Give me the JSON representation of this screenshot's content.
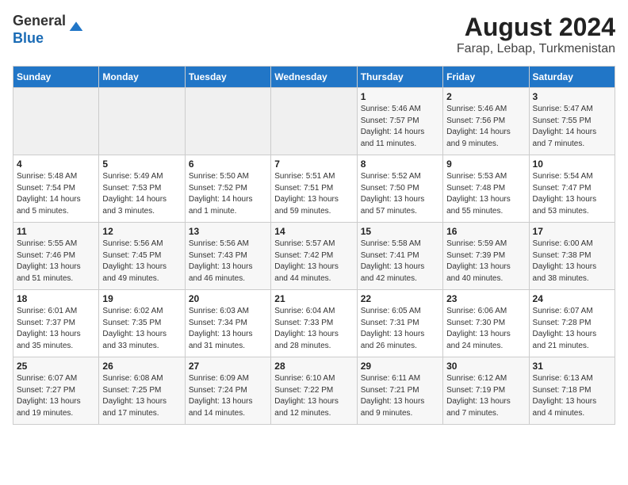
{
  "header": {
    "logo_line1": "General",
    "logo_line2": "Blue",
    "title": "August 2024",
    "subtitle": "Farap, Lebap, Turkmenistan"
  },
  "weekdays": [
    "Sunday",
    "Monday",
    "Tuesday",
    "Wednesday",
    "Thursday",
    "Friday",
    "Saturday"
  ],
  "weeks": [
    [
      {
        "day": "",
        "info": ""
      },
      {
        "day": "",
        "info": ""
      },
      {
        "day": "",
        "info": ""
      },
      {
        "day": "",
        "info": ""
      },
      {
        "day": "1",
        "info": "Sunrise: 5:46 AM\nSunset: 7:57 PM\nDaylight: 14 hours\nand 11 minutes."
      },
      {
        "day": "2",
        "info": "Sunrise: 5:46 AM\nSunset: 7:56 PM\nDaylight: 14 hours\nand 9 minutes."
      },
      {
        "day": "3",
        "info": "Sunrise: 5:47 AM\nSunset: 7:55 PM\nDaylight: 14 hours\nand 7 minutes."
      }
    ],
    [
      {
        "day": "4",
        "info": "Sunrise: 5:48 AM\nSunset: 7:54 PM\nDaylight: 14 hours\nand 5 minutes."
      },
      {
        "day": "5",
        "info": "Sunrise: 5:49 AM\nSunset: 7:53 PM\nDaylight: 14 hours\nand 3 minutes."
      },
      {
        "day": "6",
        "info": "Sunrise: 5:50 AM\nSunset: 7:52 PM\nDaylight: 14 hours\nand 1 minute."
      },
      {
        "day": "7",
        "info": "Sunrise: 5:51 AM\nSunset: 7:51 PM\nDaylight: 13 hours\nand 59 minutes."
      },
      {
        "day": "8",
        "info": "Sunrise: 5:52 AM\nSunset: 7:50 PM\nDaylight: 13 hours\nand 57 minutes."
      },
      {
        "day": "9",
        "info": "Sunrise: 5:53 AM\nSunset: 7:48 PM\nDaylight: 13 hours\nand 55 minutes."
      },
      {
        "day": "10",
        "info": "Sunrise: 5:54 AM\nSunset: 7:47 PM\nDaylight: 13 hours\nand 53 minutes."
      }
    ],
    [
      {
        "day": "11",
        "info": "Sunrise: 5:55 AM\nSunset: 7:46 PM\nDaylight: 13 hours\nand 51 minutes."
      },
      {
        "day": "12",
        "info": "Sunrise: 5:56 AM\nSunset: 7:45 PM\nDaylight: 13 hours\nand 49 minutes."
      },
      {
        "day": "13",
        "info": "Sunrise: 5:56 AM\nSunset: 7:43 PM\nDaylight: 13 hours\nand 46 minutes."
      },
      {
        "day": "14",
        "info": "Sunrise: 5:57 AM\nSunset: 7:42 PM\nDaylight: 13 hours\nand 44 minutes."
      },
      {
        "day": "15",
        "info": "Sunrise: 5:58 AM\nSunset: 7:41 PM\nDaylight: 13 hours\nand 42 minutes."
      },
      {
        "day": "16",
        "info": "Sunrise: 5:59 AM\nSunset: 7:39 PM\nDaylight: 13 hours\nand 40 minutes."
      },
      {
        "day": "17",
        "info": "Sunrise: 6:00 AM\nSunset: 7:38 PM\nDaylight: 13 hours\nand 38 minutes."
      }
    ],
    [
      {
        "day": "18",
        "info": "Sunrise: 6:01 AM\nSunset: 7:37 PM\nDaylight: 13 hours\nand 35 minutes."
      },
      {
        "day": "19",
        "info": "Sunrise: 6:02 AM\nSunset: 7:35 PM\nDaylight: 13 hours\nand 33 minutes."
      },
      {
        "day": "20",
        "info": "Sunrise: 6:03 AM\nSunset: 7:34 PM\nDaylight: 13 hours\nand 31 minutes."
      },
      {
        "day": "21",
        "info": "Sunrise: 6:04 AM\nSunset: 7:33 PM\nDaylight: 13 hours\nand 28 minutes."
      },
      {
        "day": "22",
        "info": "Sunrise: 6:05 AM\nSunset: 7:31 PM\nDaylight: 13 hours\nand 26 minutes."
      },
      {
        "day": "23",
        "info": "Sunrise: 6:06 AM\nSunset: 7:30 PM\nDaylight: 13 hours\nand 24 minutes."
      },
      {
        "day": "24",
        "info": "Sunrise: 6:07 AM\nSunset: 7:28 PM\nDaylight: 13 hours\nand 21 minutes."
      }
    ],
    [
      {
        "day": "25",
        "info": "Sunrise: 6:07 AM\nSunset: 7:27 PM\nDaylight: 13 hours\nand 19 minutes."
      },
      {
        "day": "26",
        "info": "Sunrise: 6:08 AM\nSunset: 7:25 PM\nDaylight: 13 hours\nand 17 minutes."
      },
      {
        "day": "27",
        "info": "Sunrise: 6:09 AM\nSunset: 7:24 PM\nDaylight: 13 hours\nand 14 minutes."
      },
      {
        "day": "28",
        "info": "Sunrise: 6:10 AM\nSunset: 7:22 PM\nDaylight: 13 hours\nand 12 minutes."
      },
      {
        "day": "29",
        "info": "Sunrise: 6:11 AM\nSunset: 7:21 PM\nDaylight: 13 hours\nand 9 minutes."
      },
      {
        "day": "30",
        "info": "Sunrise: 6:12 AM\nSunset: 7:19 PM\nDaylight: 13 hours\nand 7 minutes."
      },
      {
        "day": "31",
        "info": "Sunrise: 6:13 AM\nSunset: 7:18 PM\nDaylight: 13 hours\nand 4 minutes."
      }
    ]
  ]
}
